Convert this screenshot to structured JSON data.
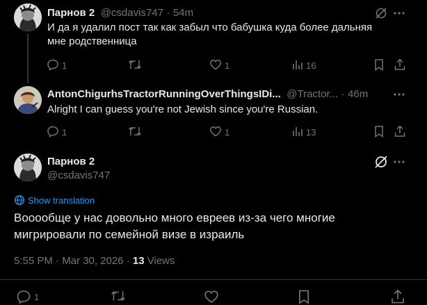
{
  "tweets": [
    {
      "name": "Парнов 2",
      "handle": "@csdavis747",
      "dot": "·",
      "time": "54m",
      "text": "И да я удалил пост так как забыл что бабушка куда более дальняя мне родственница",
      "replies": "1",
      "likes": "1",
      "views": "16"
    },
    {
      "name": "AntonChigurhsTractorRunningOverThingsIDi...",
      "handle": "@Tractor...",
      "dot": "·",
      "time": "46m",
      "text": "Alright I can guess you're not Jewish since you're Russian.",
      "replies": "1",
      "likes": "1",
      "views": "13"
    }
  ],
  "main": {
    "name": "Парнов 2",
    "handle": "@csdavis747",
    "show_translation": "Show translation",
    "text": "Вооообще у нас довольно много евреев из-за чего многие мигрировали по семейной визе в израиль",
    "timestamp": "5:55 PM · Mar 30, 2026 · ",
    "views_count": "13",
    "views_label": " Views",
    "replies": "1"
  },
  "icons": {
    "reply": "reply-icon",
    "retweet": "retweet-icon",
    "like": "heart-icon",
    "views": "views-icon",
    "bookmark": "bookmark-icon",
    "share": "share-icon",
    "grok": "grok-icon",
    "more": "more-icon",
    "translate": "translate-icon"
  },
  "colors": {
    "background": "#000000",
    "text": "#e7e9ea",
    "muted": "#71767b",
    "link": "#1d9bf0",
    "divider": "#2f3336"
  }
}
